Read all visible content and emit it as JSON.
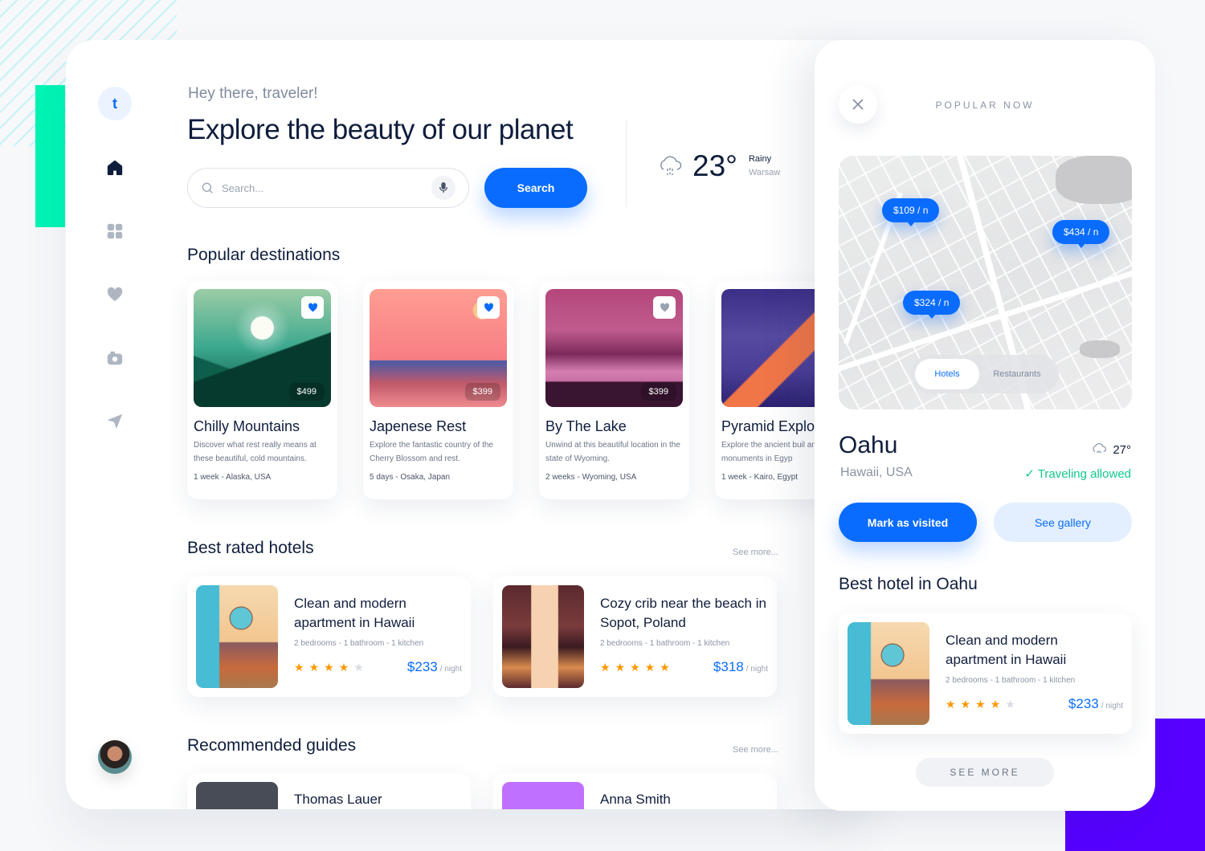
{
  "brand": {
    "logo_letter": "t"
  },
  "sidebar": {
    "items": [
      {
        "name": "home",
        "icon": "home-icon",
        "active": true
      },
      {
        "name": "grid",
        "icon": "grid-icon",
        "active": false
      },
      {
        "name": "favorites",
        "icon": "heart-icon",
        "active": false
      },
      {
        "name": "photos",
        "icon": "camera-icon",
        "active": false
      },
      {
        "name": "send",
        "icon": "send-icon",
        "active": false
      }
    ],
    "avatar": "user-avatar"
  },
  "header": {
    "greeting": "Hey there, traveler!",
    "title": "Explore the beauty of our planet",
    "search": {
      "placeholder": "Search...",
      "value": "",
      "button_label": "Search"
    }
  },
  "weather": {
    "temperature": "23°",
    "condition": "Rainy",
    "location": "Warsaw",
    "icon": "rain-cloud-icon"
  },
  "popular_destinations": {
    "title": "Popular destinations",
    "items": [
      {
        "title": "Chilly Mountains",
        "description": "Discover what rest really means at these beautiful, cold mountains.",
        "meta": "1 week - Alaska, USA",
        "price": "$499",
        "favorited": true
      },
      {
        "title": "Japenese Rest",
        "description": "Explore the fantastic country of the Cherry Blossom and rest.",
        "meta": "5 days - Osaka, Japan",
        "price": "$399",
        "favorited": true
      },
      {
        "title": "By The Lake",
        "description": "Unwind at this beautiful location in the state of Wyoming.",
        "meta": "2 weeks - Wyoming, USA",
        "price": "$399",
        "favorited": false
      },
      {
        "title": "Pyramid Explo",
        "description": "Explore the ancient buil and monuments in Egyp",
        "meta": "1 week - Kairo, Egypt",
        "price": "",
        "favorited": false
      }
    ]
  },
  "best_rated_hotels": {
    "title": "Best rated hotels",
    "see_more": "See more...",
    "items": [
      {
        "title": "Clean and modern apartment in Hawaii",
        "features": "2 bedrooms - 1 bathroom - 1 kitchen",
        "rating": 4,
        "max_rating": 5,
        "price": "$233",
        "unit": "/ night"
      },
      {
        "title": "Cozy crib near the beach in Sopot, Poland",
        "features": "2 bedrooms - 1 bathroom - 1 kitchen",
        "rating": 5,
        "max_rating": 5,
        "price": "$318",
        "unit": "/ night"
      }
    ]
  },
  "recommended_guides": {
    "title": "Recommended guides",
    "see_more": "See more...",
    "items": [
      {
        "name": "Thomas Lauer"
      },
      {
        "name": "Anna Smith"
      }
    ]
  },
  "panel": {
    "header": "POPULAR NOW",
    "map": {
      "pins": [
        {
          "label": "$109 / n"
        },
        {
          "label": "$434 / n"
        },
        {
          "label": "$324 / n"
        }
      ],
      "toggle": {
        "options": [
          "Hotels",
          "Restaurants"
        ],
        "selected": "Hotels"
      }
    },
    "place": {
      "name": "Oahu",
      "location": "Hawaii, USA",
      "temperature": "27°",
      "status": "Traveling allowed"
    },
    "buttons": {
      "primary": "Mark as visited",
      "secondary": "See gallery"
    },
    "best_hotel_title": "Best hotel in Oahu",
    "best_hotel": {
      "title": "Clean and modern apartment in Hawaii",
      "features": "2 bedrooms - 1 bathroom - 1 kitchen",
      "rating": 4,
      "max_rating": 5,
      "price": "$233",
      "unit": "/ night"
    },
    "see_more_label": "SEE MORE"
  },
  "colors": {
    "accent": "#0a6cff",
    "success": "#13c98a",
    "star": "#ff9800",
    "decor_green": "#00f5b5",
    "decor_purple": "#5600ff"
  }
}
